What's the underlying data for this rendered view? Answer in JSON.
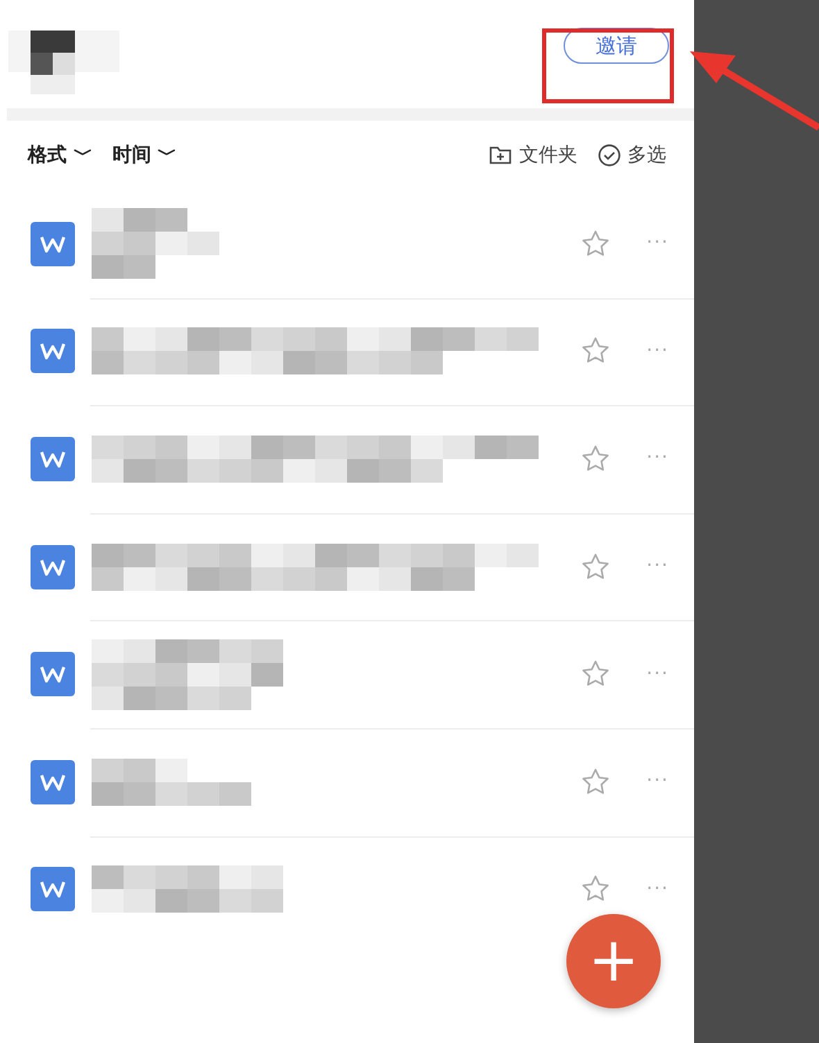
{
  "header": {
    "invite_button": "邀请"
  },
  "toolbar": {
    "filters": [
      {
        "label": "格式",
        "caret": "﹀"
      },
      {
        "label": "时间",
        "caret": "﹀"
      }
    ],
    "actions": [
      {
        "kind": "folder",
        "label": "文件夹"
      },
      {
        "kind": "multiselect",
        "label": "多选"
      }
    ]
  },
  "files": [
    {
      "starred": false,
      "more": "···"
    },
    {
      "starred": false,
      "more": "···"
    },
    {
      "starred": false,
      "more": "···"
    },
    {
      "starred": false,
      "more": "···"
    },
    {
      "starred": false,
      "more": "···"
    },
    {
      "starred": false,
      "more": "···"
    },
    {
      "starred": false,
      "more": "···"
    }
  ],
  "fab": {
    "label": "+"
  },
  "annotation": {
    "kind": "highlight"
  }
}
